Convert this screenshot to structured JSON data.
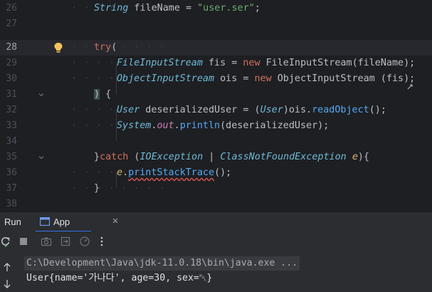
{
  "editor": {
    "lines": [
      {
        "num": "26"
      },
      {
        "num": "27"
      },
      {
        "num": "28"
      },
      {
        "num": "29"
      },
      {
        "num": "30"
      },
      {
        "num": "31"
      },
      {
        "num": "32"
      },
      {
        "num": "33"
      },
      {
        "num": "34"
      },
      {
        "num": "35"
      },
      {
        "num": "36"
      },
      {
        "num": "37"
      },
      {
        "num": "38"
      }
    ],
    "code": {
      "l26_type": "String",
      "l26_var": " fileName = ",
      "l26_str": "\"user.ser\"",
      "l26_end": ";",
      "l28_kw": "try",
      "l28_paren": "(",
      "l29_type": "FileInputStream",
      "l29_var": " fis = ",
      "l29_new": "new",
      "l29_ctor": " FileInputStream",
      "l29_args": "(fileName);",
      "l30_type": "ObjectInputStream",
      "l30_var": " ois = ",
      "l30_new": "new",
      "l30_ctor": " ObjectInputStream",
      "l30_args": " (fis);",
      "l31_paren": ")",
      "l31_brace": " {",
      "l32_type": "User",
      "l32_var": " deserializedUser = (",
      "l32_cast": "User",
      "l32_obj": ")ois.",
      "l32_fn": "readObject",
      "l32_end": "();",
      "l33_cls": "System",
      "l33_dot1": ".",
      "l33_out": "out",
      "l33_dot2": ".",
      "l33_fn": "println",
      "l33_args": "(deserializedUser);",
      "l35_brace": "}",
      "l35_kw": "catch",
      "l35_open": " (",
      "l35_ex1": "IOException",
      "l35_bar": " | ",
      "l35_ex2": "ClassNotFoundException",
      "l35_sp": " ",
      "l35_e": "e",
      "l35_close": "){",
      "l36_e": "e",
      "l36_dot": ".",
      "l36_fn": "printStackTrace",
      "l36_end": "();",
      "l37_brace": "}"
    }
  },
  "toolwindow": {
    "title": "Run",
    "tab_label": "App"
  },
  "console": {
    "command": "C:\\Development\\Java\\jdk-11.0.18\\bin\\java.exe ...",
    "output": "User{name='가나다', age=30, sex=␀}"
  },
  "colors": {
    "background": "#1e1f22",
    "toolwindow": "#2b2d30",
    "accent": "#3574f0",
    "keyword": "#cf6f5f",
    "string": "#6aab73",
    "type": "#6fb8d8",
    "method": "#56a8f5"
  }
}
